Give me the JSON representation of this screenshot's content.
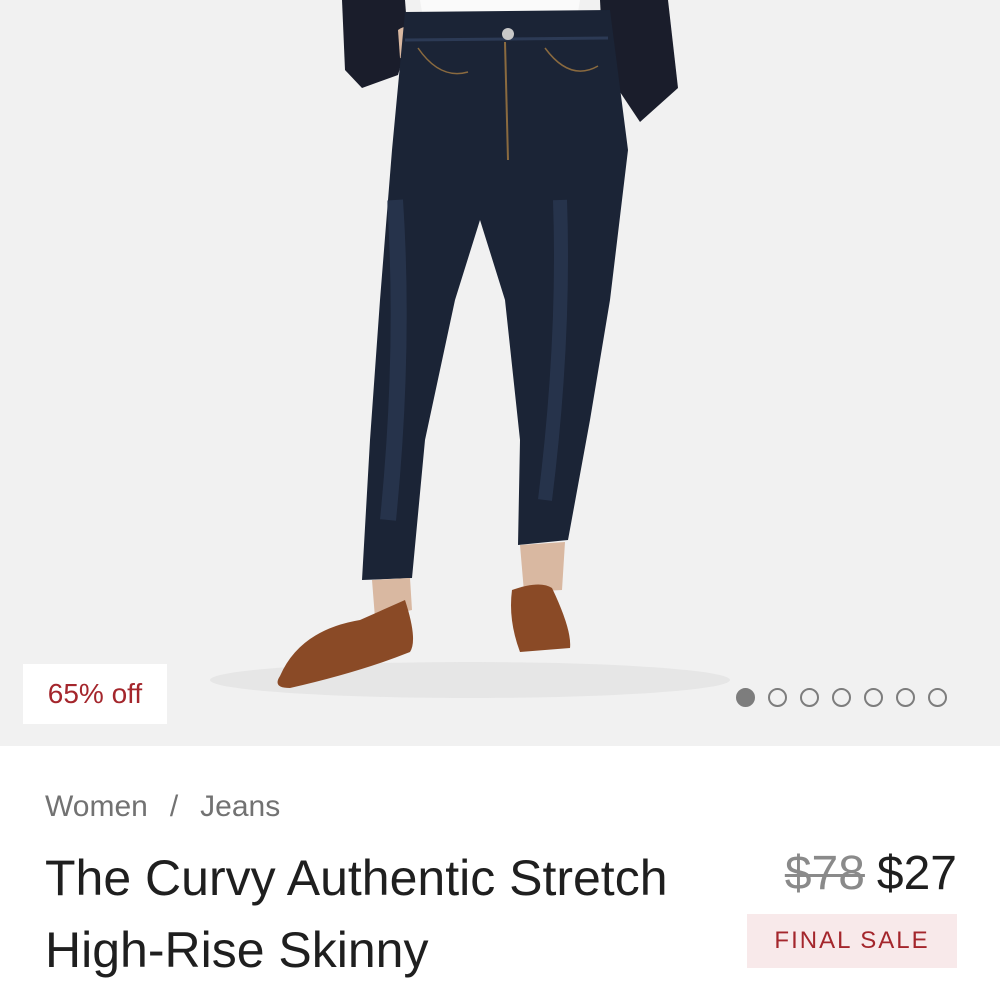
{
  "product_image": {
    "alt_icon": "product-photo-jeans",
    "badge": "65% off",
    "carousel": {
      "total": 7,
      "active_index": 0
    }
  },
  "breadcrumb": {
    "items": [
      "Women",
      "Jeans"
    ],
    "separator": "/"
  },
  "product": {
    "title": "The Curvy Authentic Stretch High-Rise Skinny",
    "price_original": "$78",
    "price_sale": "$27",
    "final_sale_label": "FINAL SALE"
  },
  "colors": {
    "sale_red": "#a4262c",
    "badge_bg": "#f8e9ea",
    "image_bg": "#f1f1f1",
    "denim": "#1b2436"
  }
}
